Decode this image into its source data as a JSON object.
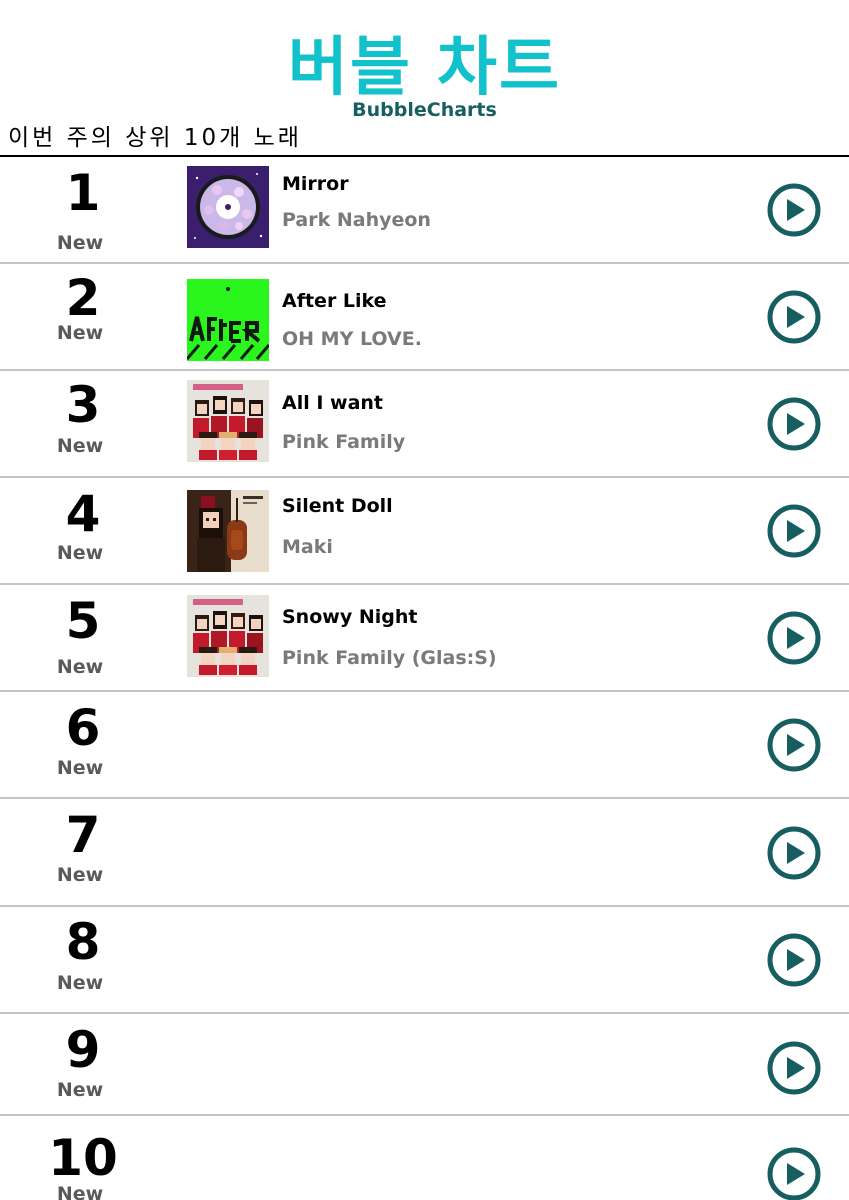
{
  "header": {
    "title": "버블 차트",
    "subtitle": "BubbleCharts",
    "section_label": "이번 주의 상위 10개 노래"
  },
  "colors": {
    "logo": "#11c1cc",
    "subtitle": "#165e60",
    "play_button": "#165e60"
  },
  "chart": {
    "entries": [
      {
        "rank": "1",
        "badge": "New",
        "title": "Mirror",
        "artist": "Park Nahyeon",
        "cover": "record-disc-art"
      },
      {
        "rank": "2",
        "badge": "New",
        "title": "After Like",
        "artist": "OH MY LOVE.",
        "cover": "green-lettering-art"
      },
      {
        "rank": "3",
        "badge": "New",
        "title": "All I want",
        "artist": "Pink Family",
        "cover": "pixel-group-christmas-art"
      },
      {
        "rank": "4",
        "badge": "New",
        "title": "Silent Doll",
        "artist": "Maki",
        "cover": "pixel-cello-doll-art"
      },
      {
        "rank": "5",
        "badge": "New",
        "title": "Snowy Night",
        "artist": "Pink Family (Glas:S)",
        "cover": "pixel-group-christmas-art"
      },
      {
        "rank": "6",
        "badge": "New",
        "title": "",
        "artist": "",
        "cover": ""
      },
      {
        "rank": "7",
        "badge": "New",
        "title": "",
        "artist": "",
        "cover": ""
      },
      {
        "rank": "8",
        "badge": "New",
        "title": "",
        "artist": "",
        "cover": ""
      },
      {
        "rank": "9",
        "badge": "New",
        "title": "",
        "artist": "",
        "cover": ""
      },
      {
        "rank": "10",
        "badge": "New",
        "title": "",
        "artist": "",
        "cover": ""
      }
    ],
    "play_icon": "play-circle-icon"
  }
}
